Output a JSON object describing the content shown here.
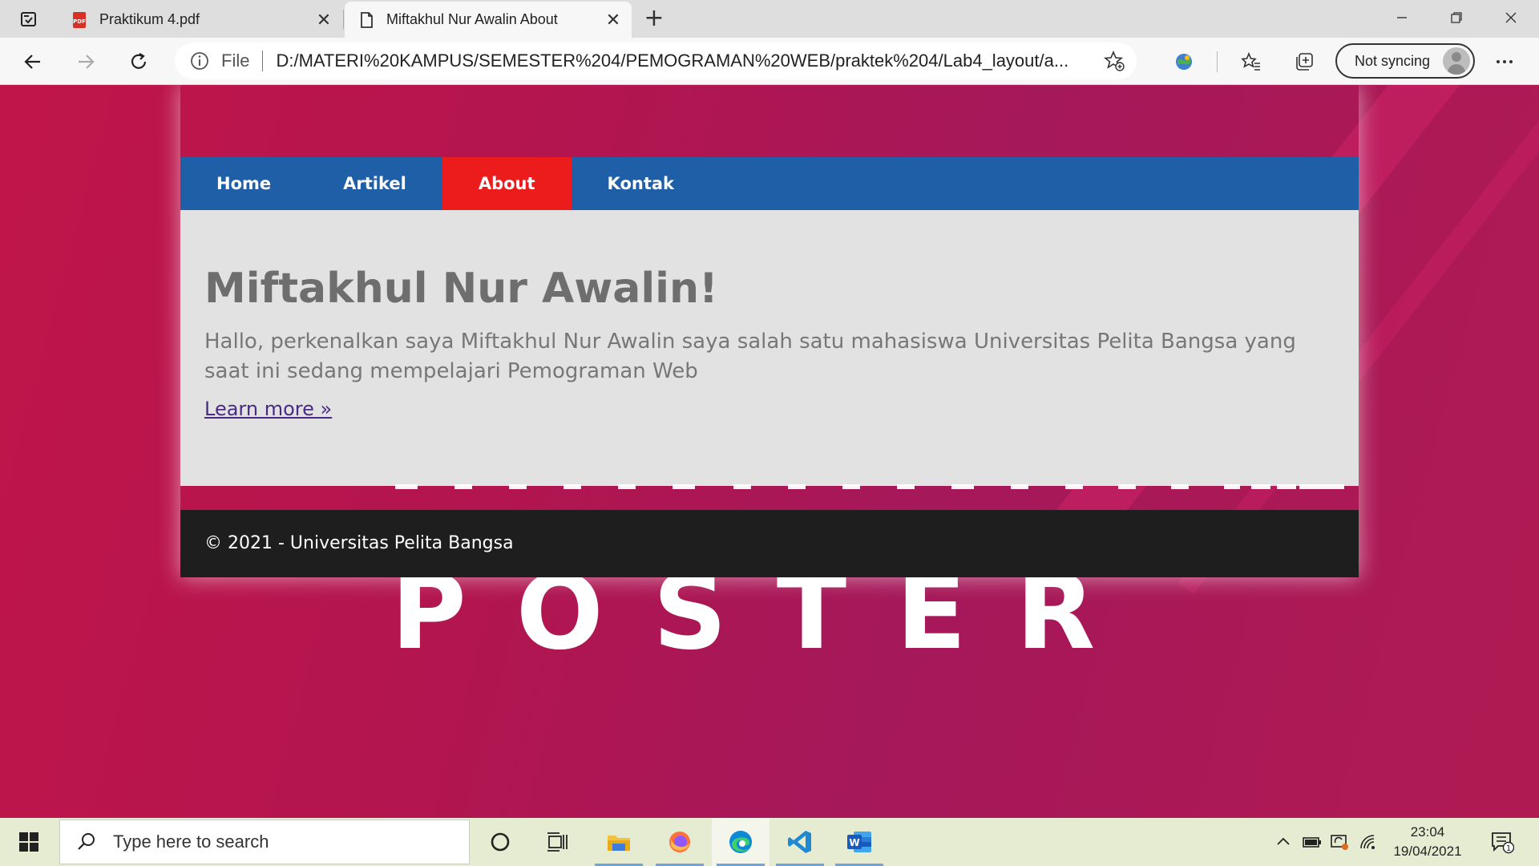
{
  "browser": {
    "tabs": [
      {
        "title": "Praktikum 4.pdf",
        "icon": "pdf-icon",
        "active": false
      },
      {
        "title": "Miftakhul Nur Awalin About",
        "icon": "page-icon",
        "active": true
      }
    ],
    "address": {
      "scheme_label": "File",
      "url": "D:/MATERI%20KAMPUS/SEMESTER%204/PEMOGRAMAN%20WEB/praktek%204/Lab4_layout/a..."
    },
    "sync_label": "Not syncing"
  },
  "page": {
    "nav": [
      {
        "label": "Home",
        "active": false
      },
      {
        "label": "Artikel",
        "active": false
      },
      {
        "label": "About",
        "active": true
      },
      {
        "label": "Kontak",
        "active": false
      }
    ],
    "hero": {
      "title": "Miftakhul Nur Awalin!",
      "text": "Hallo, perkenalkan saya Miftakhul Nur Awalin saya salah satu mahasiswa Universitas Pelita Bangsa yang saat ini sedang mempelajari Pemograman Web",
      "link": "Learn more »"
    },
    "footer": "© 2021 - Universitas Pelita Bangsa",
    "background_text": "POSTER"
  },
  "taskbar": {
    "search_placeholder": "Type here to search",
    "time": "23:04",
    "date": "19/04/2021",
    "notification_count": "1"
  },
  "colors": {
    "nav_bg": "#1f5fa8",
    "nav_active": "#ec1c1c",
    "hero_bg": "#e2e2e2",
    "footer_bg": "#1e1e1e",
    "page_bg": "#b2154f"
  }
}
